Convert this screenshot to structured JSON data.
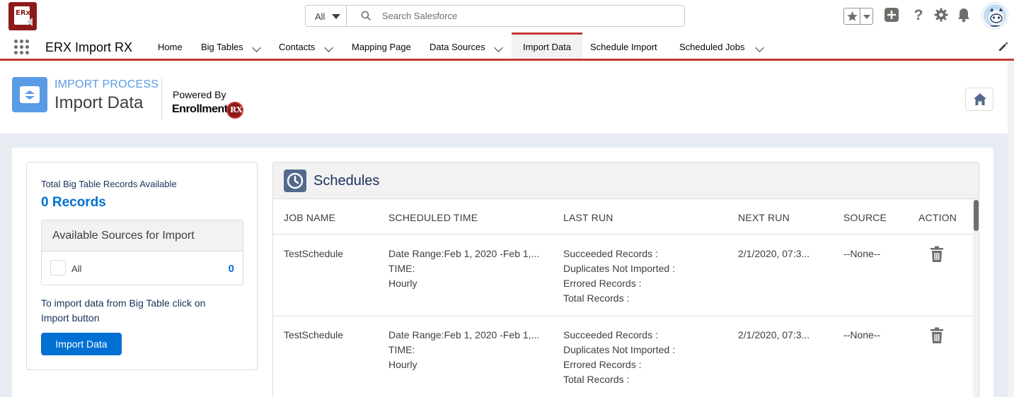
{
  "global_header": {
    "search": {
      "scope": "All",
      "placeholder": "Search Salesforce"
    }
  },
  "nav": {
    "app_name": "ERX Import RX",
    "items": [
      {
        "label": "Home",
        "has_menu": false
      },
      {
        "label": "Big Tables",
        "has_menu": true
      },
      {
        "label": "Contacts",
        "has_menu": true
      },
      {
        "label": "Mapping Page",
        "has_menu": false
      },
      {
        "label": "Data Sources",
        "has_menu": true
      },
      {
        "label": "Import Data",
        "has_menu": false,
        "active": true
      },
      {
        "label": "Schedule Import",
        "has_menu": false
      },
      {
        "label": "Scheduled Jobs",
        "has_menu": true
      }
    ]
  },
  "page_header": {
    "eyebrow": "IMPORT PROCESS",
    "title": "Import Data",
    "powered_by": "Powered By",
    "brand_text": "Enrollment",
    "brand_badge": "RX"
  },
  "left_panel": {
    "total_label": "Total Big Table Records Available",
    "total_value": "0 Records",
    "sources_title": "Available Sources for Import",
    "source_option_label": "All",
    "source_option_count": "0",
    "help_text": "To import data from Big Table click on Import button",
    "import_button": "Import Data"
  },
  "schedules": {
    "title": "Schedules",
    "columns": [
      "JOB NAME",
      "SCHEDULED TIME",
      "LAST RUN",
      "NEXT RUN",
      "SOURCE",
      "ACTION"
    ],
    "rows": [
      {
        "job_name": "TestSchedule",
        "scheduled_time": [
          "Date Range:Feb 1, 2020 -Feb 1,...",
          "TIME:",
          "Hourly"
        ],
        "last_run": [
          "Succeeded Records :",
          "Duplicates Not Imported :",
          "Errored Records :",
          "Total Records :"
        ],
        "next_run": "2/1/2020, 07:3...",
        "source": "--None--"
      },
      {
        "job_name": "TestSchedule",
        "scheduled_time": [
          "Date Range:Feb 1, 2020 -Feb 1,...",
          "TIME:",
          "Hourly"
        ],
        "last_run": [
          "Succeeded Records :",
          "Duplicates Not Imported :",
          "Errored Records :",
          "Total Records :"
        ],
        "next_run": "2/1/2020, 07:3...",
        "source": "--None--"
      }
    ]
  },
  "colors": {
    "brand_red": "#c23934",
    "primary_blue": "#0070d2",
    "header_blue": "#5a9be6",
    "body_bg": "#e6ecf2"
  },
  "icons": [
    "app-logo-icon",
    "chevron-down-icon",
    "search-icon",
    "star-icon",
    "add-icon",
    "help-icon",
    "gear-icon",
    "bell-icon",
    "app-launcher-icon",
    "pencil-icon",
    "import-process-icon",
    "home-icon",
    "clock-icon",
    "trash-icon"
  ]
}
